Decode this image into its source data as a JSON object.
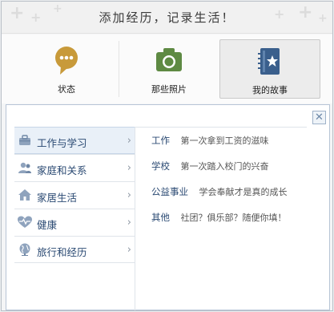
{
  "header": {
    "title": "添加经历，记录生活！"
  },
  "tabs": [
    {
      "label": "状态",
      "icon": "speech-bubble-icon",
      "color": "#c89a3a"
    },
    {
      "label": "那些照片",
      "icon": "camera-icon",
      "color": "#5e8a43"
    },
    {
      "label": "我的故事",
      "icon": "story-book-icon",
      "color": "#3a5f8c",
      "active": true
    }
  ],
  "panel": {
    "close_symbol": "✕",
    "categories": [
      {
        "label": "工作与学习",
        "icon": "briefcase-icon",
        "active": true
      },
      {
        "label": "家庭和关系",
        "icon": "people-icon"
      },
      {
        "label": "家居生活",
        "icon": "house-icon"
      },
      {
        "label": "健康",
        "icon": "heart-icon"
      },
      {
        "label": "旅行和经历",
        "icon": "globe-icon"
      }
    ],
    "items": [
      {
        "key": "工作",
        "text": "第一次拿到工资的滋味"
      },
      {
        "key": "学校",
        "text": "第一次踏入校门的兴奋"
      },
      {
        "key": "公益事业",
        "text": "学会奉献才是真的成长"
      },
      {
        "key": "其他",
        "text": "社团？俱乐部？随便你填！"
      }
    ]
  }
}
